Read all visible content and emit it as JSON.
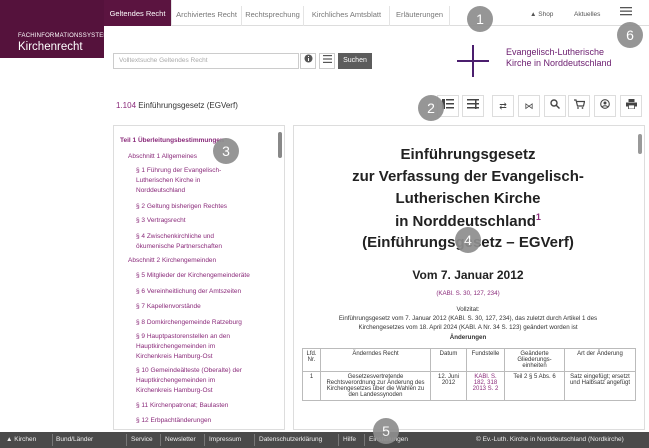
{
  "brand": {
    "line1": "FACHINFORMATIONSSYSTEM",
    "line2": "Kirchenrecht"
  },
  "topnav": {
    "tabs": [
      "Geltendes Recht",
      "Archiviertes Recht",
      "Rechtsprechung",
      "Kirchliches Amtsblatt",
      "Erläuterungen"
    ],
    "shop": "▲ Shop",
    "aktuelles": "Aktuelles",
    "menu_icon": "menu-icon"
  },
  "search": {
    "placeholder": "Volltextsuche Geltendes Recht",
    "button": "Suchen"
  },
  "logo": {
    "line1": "Evangelisch-Lutherische",
    "line2": "Kirche in Norddeutschland"
  },
  "doc_title": {
    "num": "1.104",
    "name": " Einführungsgesetz (EGVerf)"
  },
  "toolbar_icons": [
    "toc-icon",
    "collapse-icon",
    "compare-icon",
    "split-icon",
    "search-icon",
    "cart-icon",
    "user-icon",
    "print-icon"
  ],
  "toc": [
    "Teil 1 Überleitungsbestimmungen",
    "Abschnitt 1 Allgemeines",
    "§ 1 Führung der Evangelisch-",
    "Lutherischen Kirche in",
    "Norddeutschland",
    "§ 2 Geltung bisherigen Rechtes",
    "§ 3 Vertragsrecht",
    "§ 4 Zwischenkirchliche und",
    "ökumenische Partnerschaften",
    "Abschnitt 2 Kirchengemeinden",
    "§ 5 Mitglieder der Kirchengemeinderäte",
    "§ 6 Vereinheitlichung der Amtszeiten",
    "§ 7 Kapellenvorstände",
    "§ 8 Domkirchengemeinde Ratzeburg",
    "§ 9 Hauptpastorenstellen an den",
    "Hauptkirchengemeinden im",
    "Kirchenkreis Hamburg-Ost",
    "§ 10 Gemeindeälteste (Oberalte) der",
    "Hauptkirchengemeinden im",
    "Kirchenkreis Hamburg-Ost",
    "§ 11 Kirchenpatronat; Baulasten",
    "§ 12 Erbpachtänderungen"
  ],
  "doc": {
    "title1": "Einführungsgesetz",
    "title2": "zur Verfassung der Evangelisch-",
    "title3": "Lutherischen Kirche",
    "title4": "in Norddeutschland",
    "title_sup": "1",
    "title5": "(Einführungsgesetz – EGVerf)",
    "date": "Vom 7. Januar 2012",
    "ref": "(KABl. S. 30, 127, 234)",
    "vollzitat_label": "Vollzitat:",
    "vollzitat_1": "Einführungsgesetz vom 7. Januar 2012 (KABl. S. 30, 127, 234), das zuletzt durch Artikel 1 des",
    "vollzitat_2": "Kirchengesetzes vom 18. April 2024 (KABl. A Nr. 34 S. 123) geändert worden ist",
    "aenderungen": "Änderungen",
    "table_headers": [
      "Lfd. Nr.",
      "Änderndes Recht",
      "Datum",
      "Fundstelle",
      "Geänderte Gliederungs-einheiten",
      "Art der Änderung"
    ],
    "row1": [
      "1",
      "Gesetzesvertretende Rechtsverordnung zur Änderung des Kirchengesetzes über die Wahlen zu den Landessynoden",
      "12. Juni 2012",
      "KABl. S. 182, 318 2013 S. 2",
      "Teil 2 § 5 Abs. 6",
      "Satz eingefügt; ersetzt und Halbsatz angefügt"
    ]
  },
  "footer": {
    "left_arrow": "▲ Kirchen",
    "bund": "Bund/Länder",
    "links": [
      "Service",
      "Newsletter",
      "Impressum",
      "Datenschutzerklärung",
      "Hilfe",
      "Einstellungen"
    ],
    "copyright": "© Ev.-Luth. Kirche in Norddeutschland (Nordkirche)"
  },
  "callouts": [
    "1",
    "2",
    "3",
    "4",
    "5",
    "6"
  ]
}
